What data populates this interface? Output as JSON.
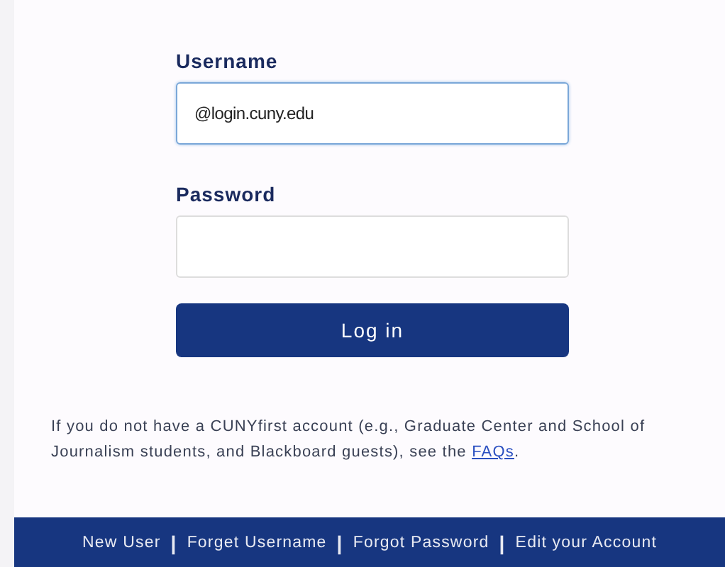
{
  "form": {
    "username": {
      "label": "Username",
      "value": "@login.cuny.edu"
    },
    "password": {
      "label": "Password"
    },
    "submit": "Log in"
  },
  "note": {
    "text": "If you do not have a CUNYfirst account (e.g., Graduate Center and School of Journalism students, and Blackboard guests), see the ",
    "link": "FAQs",
    "after": "."
  },
  "footer": {
    "separator": "|",
    "links": [
      "New User",
      "Forget Username",
      "Forgot Password",
      "Edit your Account"
    ]
  }
}
